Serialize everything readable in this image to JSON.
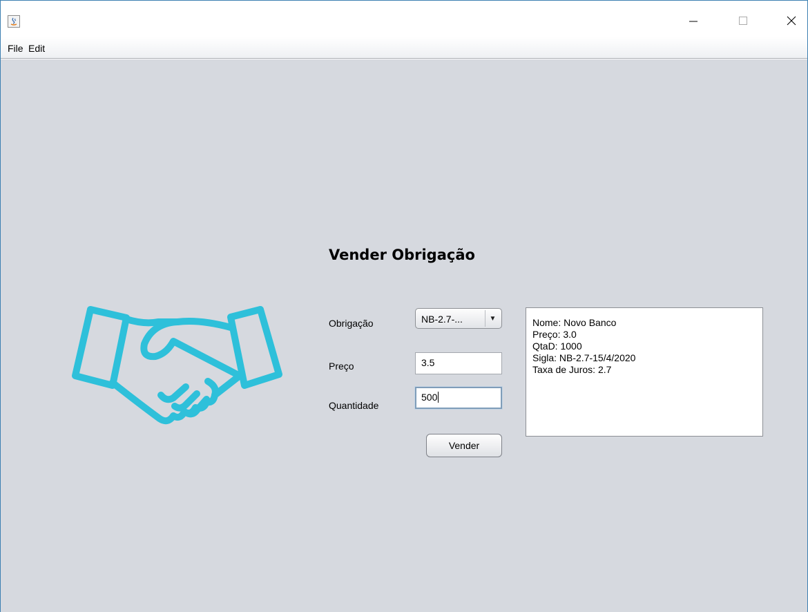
{
  "window": {
    "icon": "java-app-icon",
    "controls": {
      "minimize": "minimize-icon",
      "maximize": "maximize-icon",
      "close": "close-icon"
    }
  },
  "menubar": {
    "file": "File",
    "edit": "Edit"
  },
  "form": {
    "title": "Vender Obrigação",
    "obrigacao_label": "Obrigação",
    "obrigacao_selected": "NB-2.7-...",
    "preco_label": "Preço",
    "preco_value": "3.5",
    "quantidade_label": "Quantidade",
    "quantidade_value": "500",
    "submit_label": "Vender"
  },
  "info": {
    "lines": [
      "Nome: Novo Banco",
      "Preço: 3.0",
      "QtaD: 1000",
      "Sigla: NB-2.7-15/4/2020",
      "Taxa de Juros: 2.7"
    ]
  },
  "colors": {
    "background": "#d6d9df",
    "accent_icon": "#2ec0da",
    "window_border": "#3c7fb1"
  }
}
